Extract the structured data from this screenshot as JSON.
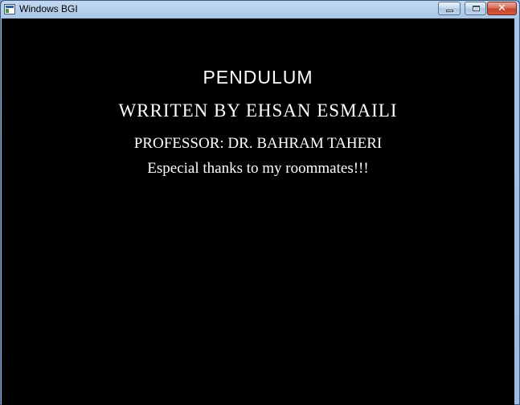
{
  "window": {
    "title": "Windows BGI",
    "controls": {
      "minimize_icon": "minimize-icon",
      "maximize_icon": "maximize-icon",
      "close_label": "✕"
    }
  },
  "canvas": {
    "background": "#000000",
    "text_color": "#ffffff",
    "lines": {
      "title": "PENDULUM",
      "author": "WRRITEN BY EHSAN ESMAILI",
      "professor": "PROFESSOR: DR. BAHRAM TAHERI",
      "thanks": "Especial thanks to my roommates!!!"
    }
  }
}
